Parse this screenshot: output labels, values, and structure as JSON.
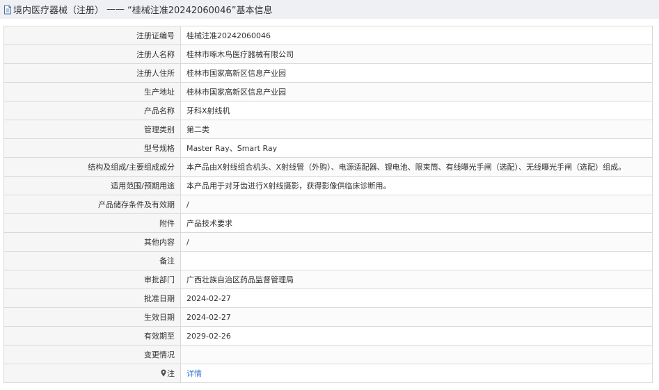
{
  "header": {
    "prefix": "境内医疗器械（注册）",
    "separator": "——",
    "title": "“桂械注准20242060046”基本信息"
  },
  "rows": [
    {
      "label": "注册证编号",
      "value": "桂械注准20242060046"
    },
    {
      "label": "注册人名称",
      "value": "桂林市啄木鸟医疗器械有限公司"
    },
    {
      "label": "注册人住所",
      "value": "桂林市国家高新区信息产业园"
    },
    {
      "label": "生产地址",
      "value": "桂林市国家高新区信息产业园"
    },
    {
      "label": "产品名称",
      "value": "牙科X射线机"
    },
    {
      "label": "管理类别",
      "value": "第二类"
    },
    {
      "label": "型号规格",
      "value": "Master Ray、Smart Ray"
    },
    {
      "label": "结构及组成/主要组成成分",
      "value": "本产品由X射线组合机头、X射线管（外购）、电源适配器、锂电池、限束筒、有线曝光手闸（选配）、无线曝光手闸（选配）组成。"
    },
    {
      "label": "适用范围/预期用途",
      "value": "本产品用于对牙齿进行X射线摄影，获得影像供临床诊断用。"
    },
    {
      "label": "产品储存条件及有效期",
      "value": "/"
    },
    {
      "label": "附件",
      "value": "产品技术要求"
    },
    {
      "label": "其他内容",
      "value": "/"
    },
    {
      "label": "备注",
      "value": ""
    },
    {
      "label": "审批部门",
      "value": "广西壮族自治区药品监督管理局"
    },
    {
      "label": "批准日期",
      "value": "2024-02-27"
    },
    {
      "label": "生效日期",
      "value": "2024-02-27"
    },
    {
      "label": "有效期至",
      "value": "2029-02-26"
    },
    {
      "label": "变更情况",
      "value": ""
    }
  ],
  "note": {
    "label": "注",
    "link": "详情",
    "icon": "location-pin-icon"
  },
  "colors": {
    "header_bg": "#eef0f3",
    "label_bg": "#f6f6f6",
    "border": "#d9d9d9",
    "link": "#3b7fd0"
  }
}
